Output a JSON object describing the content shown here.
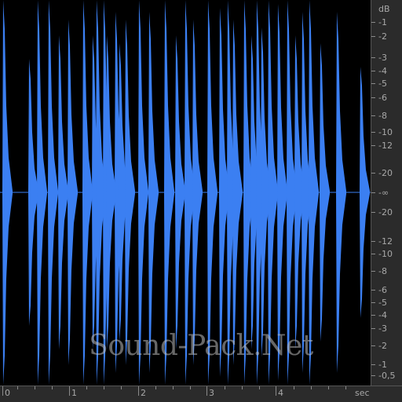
{
  "colors": {
    "waveform": "#3b7ff2",
    "background": "#000000",
    "ruler_bg": "#2b2b2b",
    "ruler_text": "#a8a8a8"
  },
  "db_ruler": {
    "unit": "dB",
    "labels": [
      "-1",
      "-2",
      "-3",
      "-4",
      "-5",
      "-6",
      "-8",
      "-10",
      "-12",
      "-20",
      "-∞",
      "-20",
      "-12",
      "-10",
      "-8",
      "-6",
      "-5",
      "-4",
      "-3",
      "-2",
      "-1",
      "-0,5"
    ]
  },
  "time_ruler": {
    "unit": "sec",
    "labels": [
      "0",
      "1",
      "2",
      "3",
      "4"
    ]
  },
  "watermark": "Sound-Pack.Net"
}
